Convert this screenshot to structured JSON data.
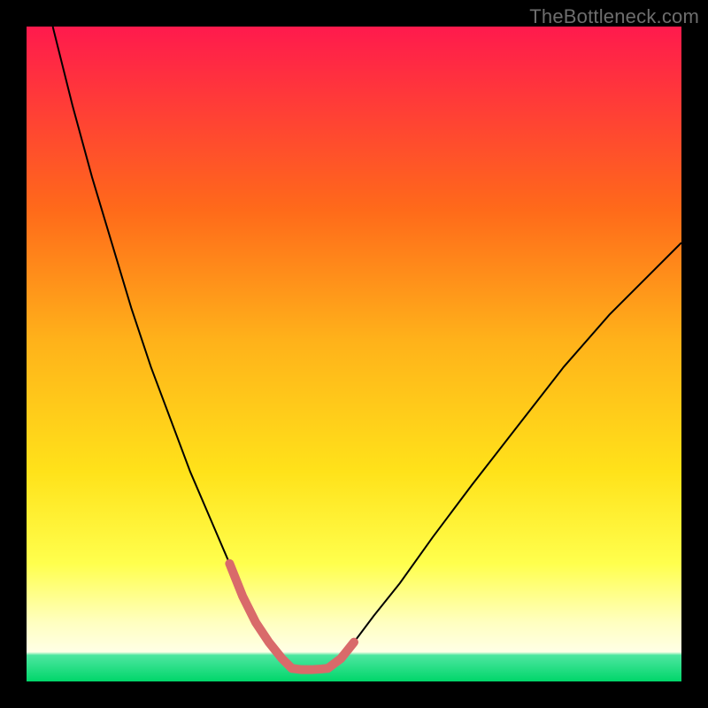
{
  "watermark": "TheBottleneck.com",
  "chart_data": {
    "type": "line",
    "title": "",
    "xlabel": "",
    "ylabel": "",
    "xlim": [
      0,
      100
    ],
    "ylim": [
      0,
      100
    ],
    "background_gradient": {
      "top_color": "#ff1a4d",
      "mid_upper_color": "#ff9a1a",
      "mid_color": "#ffe21a",
      "mid_lower_color": "#ffff1a",
      "near_bottom_color": "#ffffb0",
      "bottom_band_color": "#00e273"
    },
    "series": [
      {
        "name": "left-curve",
        "stroke": "#000000",
        "width": 2,
        "x": [
          4,
          7,
          10,
          13,
          16,
          19,
          22,
          25,
          28,
          31,
          33,
          35,
          37,
          39,
          40.5
        ],
        "y": [
          100,
          88,
          77,
          67,
          57,
          48,
          40,
          32,
          25,
          18,
          13,
          9,
          6,
          3.5,
          2
        ]
      },
      {
        "name": "right-curve",
        "stroke": "#000000",
        "width": 2,
        "x": [
          46,
          48,
          50,
          53,
          57,
          62,
          68,
          75,
          82,
          89,
          95,
          100
        ],
        "y": [
          2,
          3.5,
          6,
          10,
          15,
          22,
          30,
          39,
          48,
          56,
          62,
          67
        ]
      },
      {
        "name": "highlight-left",
        "stroke": "#d96a6a",
        "width": 10,
        "linecap": "round",
        "x": [
          31,
          33,
          35,
          37,
          39,
          40.5
        ],
        "y": [
          18,
          13,
          9,
          6,
          3.5,
          2
        ]
      },
      {
        "name": "highlight-bottom",
        "stroke": "#d96a6a",
        "width": 10,
        "linecap": "round",
        "x": [
          40.5,
          42,
          43.5,
          45,
          46
        ],
        "y": [
          2,
          1.8,
          1.8,
          1.9,
          2
        ]
      },
      {
        "name": "highlight-right",
        "stroke": "#d96a6a",
        "width": 10,
        "linecap": "round",
        "x": [
          46,
          48,
          50
        ],
        "y": [
          2,
          3.5,
          6
        ]
      }
    ],
    "annotations": []
  }
}
